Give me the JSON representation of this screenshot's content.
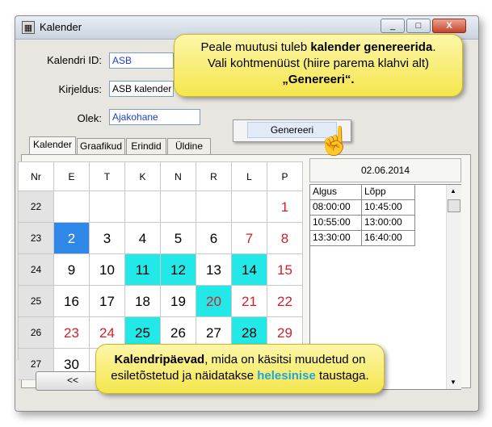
{
  "window": {
    "title": "Kalender",
    "icon": "calendar-app-icon",
    "minimize_label": "_",
    "maximize_label": "□",
    "close_label": "X"
  },
  "form": {
    "id_label": "Kalendri ID:",
    "id_value": "ASB",
    "desc_label": "Kirjeldus:",
    "desc_value": "ASB kalender",
    "status_label": "Olek:",
    "status_value": "Ajakohane"
  },
  "tabs": [
    {
      "label": "Kalender",
      "active": true
    },
    {
      "label": "Graafikud",
      "active": false
    },
    {
      "label": "Erindid",
      "active": false
    },
    {
      "label": "Üldine",
      "active": false
    }
  ],
  "calendar": {
    "headers": [
      "Nr",
      "E",
      "T",
      "K",
      "N",
      "R",
      "L",
      "P"
    ],
    "rows": [
      {
        "week": "22",
        "days": [
          "",
          "",
          "",
          "",
          "",
          "",
          "1"
        ],
        "red": [
          false,
          false,
          false,
          false,
          false,
          false,
          true
        ],
        "cyan": [
          false,
          false,
          false,
          false,
          false,
          false,
          false
        ]
      },
      {
        "week": "23",
        "days": [
          "2",
          "3",
          "4",
          "5",
          "6",
          "7",
          "8"
        ],
        "red": [
          false,
          false,
          false,
          false,
          false,
          true,
          true
        ],
        "cyan": [
          false,
          false,
          false,
          false,
          false,
          false,
          false
        ],
        "selected": 0
      },
      {
        "week": "24",
        "days": [
          "9",
          "10",
          "11",
          "12",
          "13",
          "14",
          "15"
        ],
        "red": [
          false,
          false,
          false,
          false,
          false,
          false,
          true
        ],
        "cyan": [
          false,
          false,
          true,
          true,
          false,
          true,
          false
        ]
      },
      {
        "week": "25",
        "days": [
          "16",
          "17",
          "18",
          "19",
          "20",
          "21",
          "22"
        ],
        "red": [
          false,
          false,
          false,
          false,
          true,
          true,
          true
        ],
        "cyan": [
          false,
          false,
          false,
          false,
          true,
          false,
          false
        ]
      },
      {
        "week": "26",
        "days": [
          "23",
          "24",
          "25",
          "26",
          "27",
          "28",
          "29"
        ],
        "red": [
          true,
          true,
          false,
          false,
          false,
          false,
          true
        ],
        "cyan": [
          false,
          false,
          true,
          false,
          false,
          true,
          false
        ]
      },
      {
        "week": "27",
        "days": [
          "30",
          "",
          "",
          "",
          "",
          "",
          ""
        ],
        "red": [
          false,
          false,
          false,
          false,
          false,
          false,
          false
        ],
        "cyan": [
          false,
          false,
          false,
          false,
          false,
          false,
          false
        ]
      }
    ],
    "prev_button": "<<"
  },
  "schedule": {
    "date": "02.06.2014",
    "col_start": "Algus",
    "col_end": "Lõpp",
    "rows": [
      {
        "start": "08:00:00",
        "end": "10:45:00"
      },
      {
        "start": "10:55:00",
        "end": "13:00:00"
      },
      {
        "start": "13:30:00",
        "end": "16:40:00"
      }
    ]
  },
  "context_menu": {
    "item": "Genereeri"
  },
  "callout_top": {
    "line1_pre": "Peale muutusi tuleb ",
    "line1_bold": "kalender genereerida",
    "line1_post": ".",
    "line2": "Vali kohtmenüüst (hiire parema klahvi alt)",
    "line3_bold": "„Genereeri“."
  },
  "callout_bottom": {
    "line1_bold": "Kalendripäevad",
    "line1_post": ", mida on käsitsi muudetud on",
    "line2_pre": "esiletõstetud ja näidatakse ",
    "line2_hl": "helesinise",
    "line2_post": "  taustaga."
  },
  "colors": {
    "highlight": "#22e8e8",
    "selected": "#2f87e8",
    "weekend_red": "#d0202a",
    "callout_bg": "#f4e64c"
  }
}
